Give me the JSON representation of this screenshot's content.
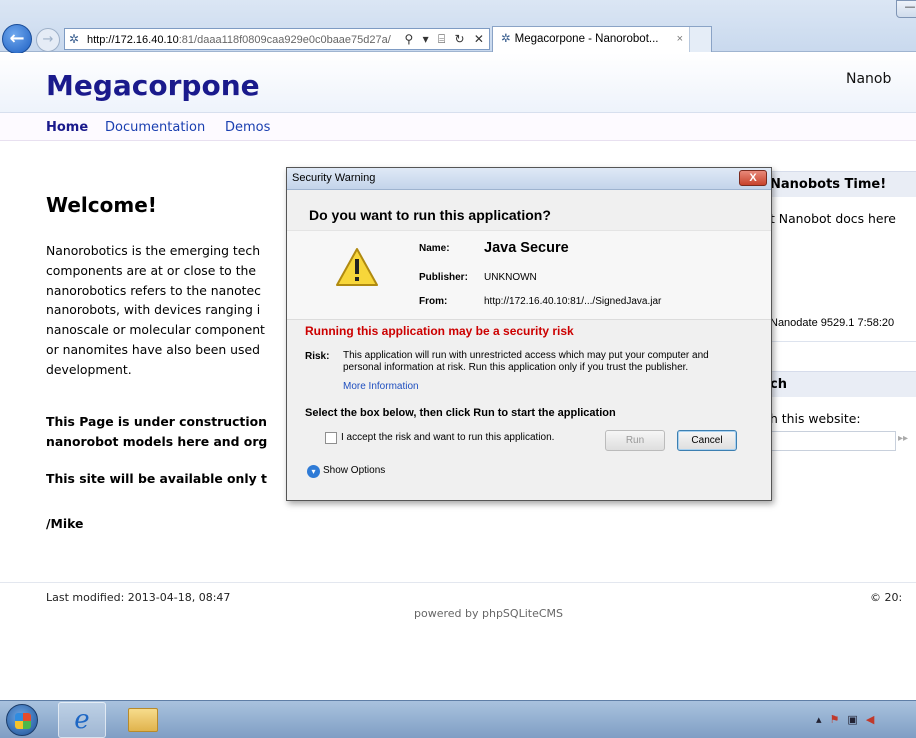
{
  "browser": {
    "url_host": "http://172.16.40.10",
    "url_rest": ":81/daaa118f0809caa929e0c0baae75d27a/",
    "tab_title": "Megacorpone - Nanorobot...",
    "tab_close": "×",
    "back_glyph": "←",
    "forward_glyph": "→",
    "address_icons": "⚲ ▾ ⌸ ↻ ✕",
    "minimize": "—"
  },
  "site": {
    "name": "Megacorpone",
    "slogan": "Nanob",
    "nav": {
      "home": "Home",
      "documentation": "Documentation",
      "demos": "Demos"
    },
    "welcome": "Welcome!",
    "paragraph": [
      "Nanorobotics is the emerging tech",
      "components are at or close to the",
      "nanorobotics refers to the nanotec",
      "nanorobots, with devices ranging i",
      "nanoscale or molecular component",
      "or nanomites have also been used",
      "development."
    ],
    "construction": [
      "This Page is under construction",
      "nanorobot models here and org"
    ],
    "available": "This site will be available only t",
    "signature": "/Mike",
    "sidebar": {
      "box1_title": "Nanobots Time!",
      "box1_text": "t Nanobot docs here",
      "nanodate": "Nanodate 9529.1 7:58:20",
      "box2_title": "ch",
      "box2_text": "h this website:",
      "search_go": "▸▸"
    },
    "footer": {
      "last_modified": "Last modified: 2013-04-18, 08:47",
      "copyright": "© 20:",
      "powered": "powered by phpSQLiteCMS"
    }
  },
  "dialog": {
    "title": "Security Warning",
    "close": "X",
    "question": "Do you want to run this application?",
    "name_label": "Name:",
    "name_value": "Java Secure",
    "publisher_label": "Publisher:",
    "publisher_value": "UNKNOWN",
    "from_label": "From:",
    "from_value": "http://172.16.40.10:81/.../SignedJava.jar",
    "risk_heading": "Running this application may be a security risk",
    "risk_label": "Risk:",
    "risk_text": "This application will run with unrestricted access which may put your computer and personal information at risk. Run this application only if you trust the publisher.",
    "more_info": "More Information",
    "instruction": "Select the box below, then click Run to start the application",
    "checkbox_label": "I accept the risk and want to run this application.",
    "run_button": "Run",
    "cancel_button": "Cancel",
    "show_options": "Show Options"
  },
  "taskbar": {
    "ie_glyph": "e"
  },
  "colors": {
    "site_title": "#1a1a8c",
    "risk_red": "#cc0000",
    "link_blue": "#1a3fb0"
  }
}
